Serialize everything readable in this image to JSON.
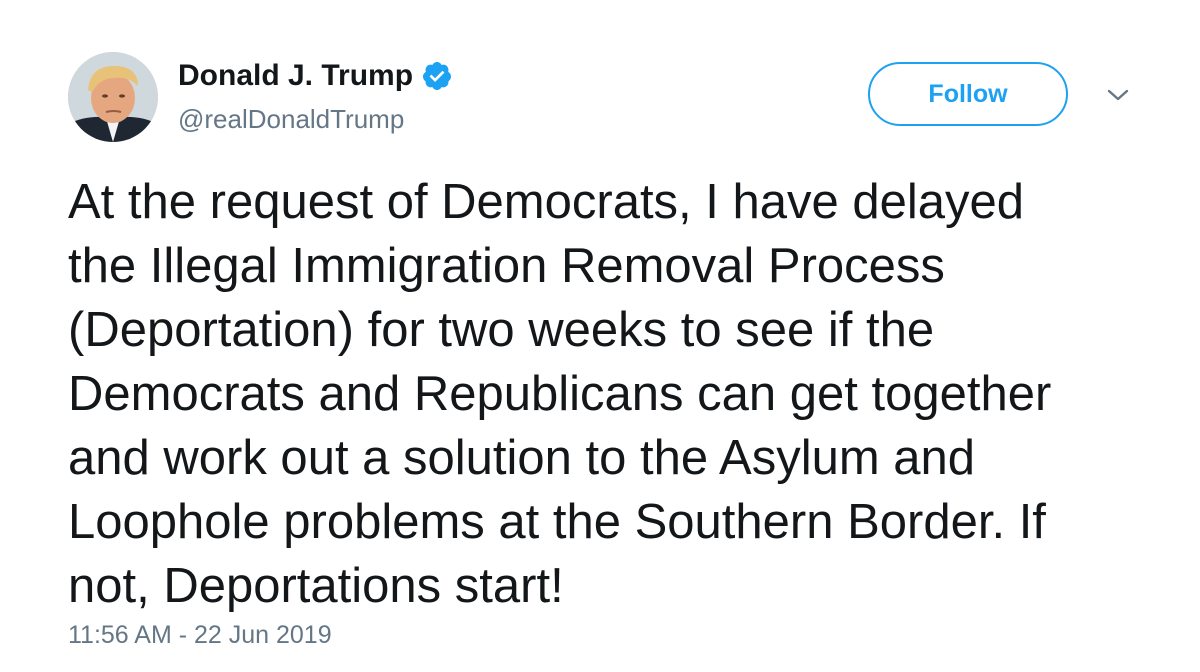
{
  "tweet": {
    "author": {
      "display_name": "Donald J. Trump",
      "handle": "@realDonaldTrump",
      "verified": true,
      "avatar_icon": "profile-photo"
    },
    "follow_label": "Follow",
    "menu_icon": "chevron-down-icon",
    "text": "At the request of Democrats, I have delayed\nthe Illegal Immigration Removal Process\n(Deportation) for two weeks to see if the\nDemocrats and Republicans can get together\nand work out a solution to the Asylum and\nLoophole problems at the Southern Border. If\nnot, Deportations start!",
    "timestamp": "11:56 AM - 22 Jun 2019"
  },
  "colors": {
    "accent": "#1da1f2",
    "text_primary": "#14171a",
    "text_secondary": "#657786",
    "background": "#ffffff"
  }
}
